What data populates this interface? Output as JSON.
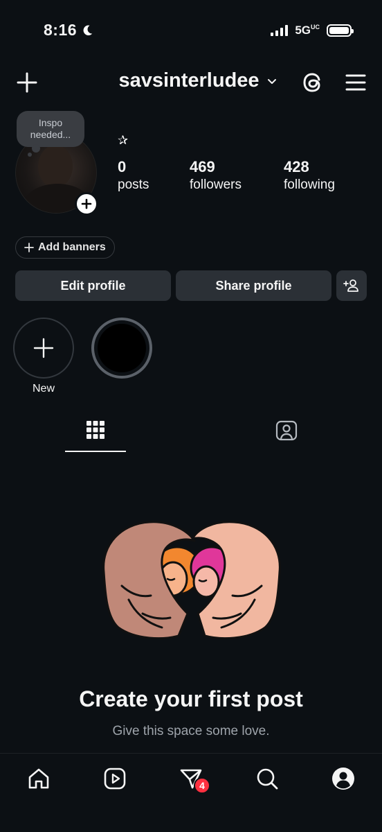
{
  "status_bar": {
    "time": "8:16",
    "network": "5G",
    "network_suffix": "UC"
  },
  "header": {
    "username": "savsinterludee"
  },
  "profile": {
    "note": {
      "line1": "Inspo",
      "line2": "needed..."
    },
    "bio_symbol": "✰",
    "stats": {
      "posts": {
        "count": "0",
        "label": "posts"
      },
      "followers": {
        "count": "469",
        "label": "followers"
      },
      "following": {
        "count": "428",
        "label": "following"
      }
    },
    "add_banners_label": "Add banners",
    "edit_profile_label": "Edit profile",
    "share_profile_label": "Share profile"
  },
  "highlights": {
    "new_label": "New"
  },
  "empty_state": {
    "title": "Create your first post",
    "subtitle": "Give this space some love."
  },
  "bottom_nav": {
    "notification_count": "4"
  },
  "colors": {
    "background": "#0c1014",
    "button": "#2b3036",
    "badge": "#ff3040"
  }
}
